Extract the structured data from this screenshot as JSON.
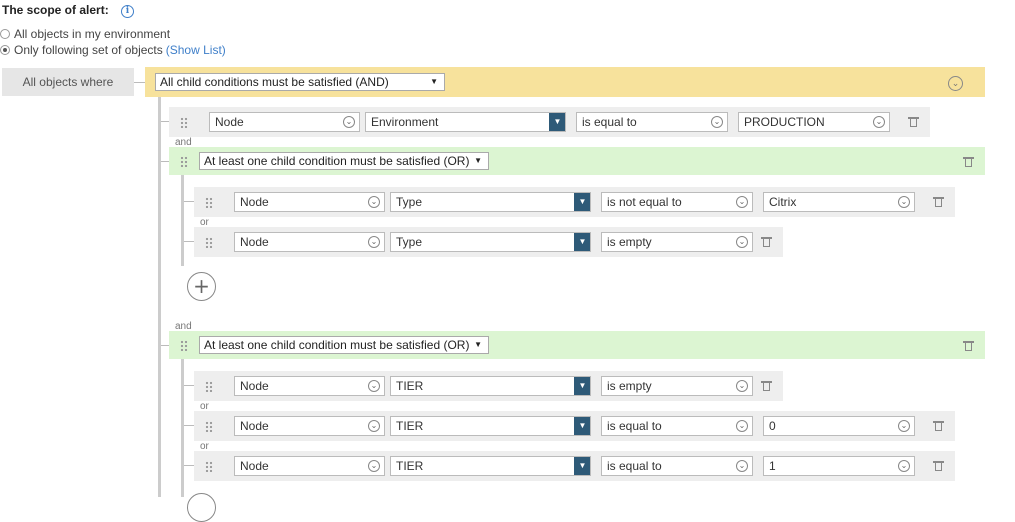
{
  "scope": {
    "title": "The scope of alert:",
    "info_icon": "info-icon",
    "option_all": "All objects in my environment",
    "option_following": "Only following set of objects",
    "show_list": "(Show List)"
  },
  "root": {
    "label": "All objects where",
    "operator": "All child conditions must be satisfied (AND)"
  },
  "separators": {
    "and": "and",
    "or": "or"
  },
  "condition1": {
    "entity": "Node",
    "field": "Environment",
    "operator": "is equal to",
    "value": "PRODUCTION"
  },
  "group1": {
    "operator": "At least one child condition must be satisfied (OR)",
    "rows": [
      {
        "entity": "Node",
        "field": "Type",
        "operator": "is not equal to",
        "value": "Citrix"
      },
      {
        "entity": "Node",
        "field": "Type",
        "operator": "is empty",
        "value": ""
      }
    ]
  },
  "group2": {
    "operator": "At least one child condition must be satisfied (OR)",
    "rows": [
      {
        "entity": "Node",
        "field": "TIER",
        "operator": "is empty",
        "value": ""
      },
      {
        "entity": "Node",
        "field": "TIER",
        "operator": "is equal to",
        "value": "0"
      },
      {
        "entity": "Node",
        "field": "TIER",
        "operator": "is equal to",
        "value": "1"
      }
    ]
  },
  "colors": {
    "and_bar": "#f7e29c",
    "or_bar": "#dcf5d2",
    "field_button": "#2e5a78",
    "link": "#3f7fc9"
  }
}
